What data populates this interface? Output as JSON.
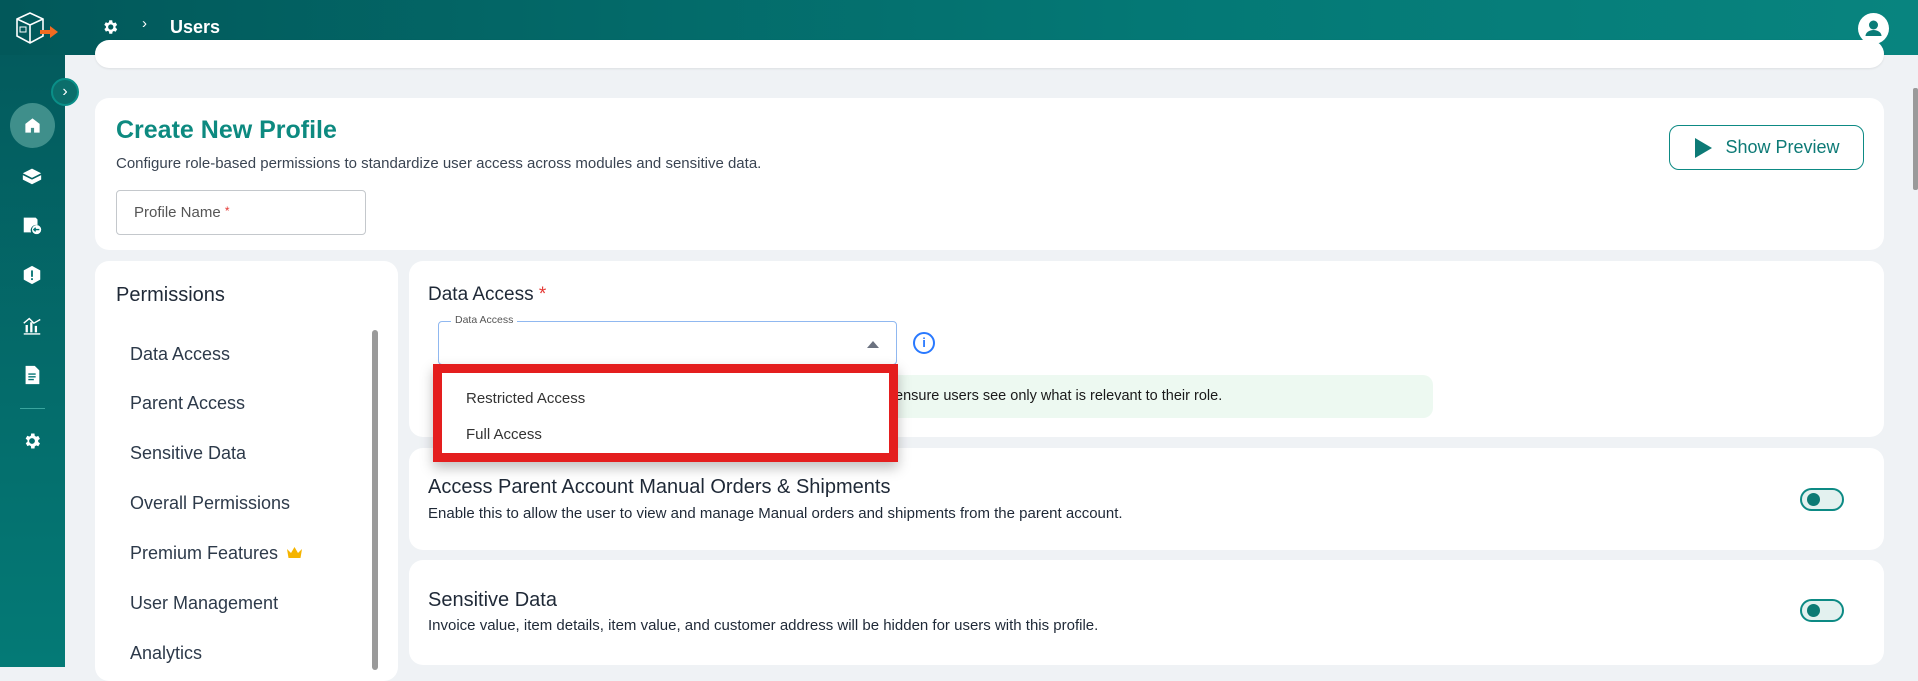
{
  "header": {
    "breadcrumb_current": "Users"
  },
  "sidebar": {
    "items": [
      "home",
      "orders",
      "returns",
      "issues",
      "analytics",
      "reports",
      "settings"
    ]
  },
  "create_profile": {
    "title": "Create New Profile",
    "subtitle": "Configure role-based permissions to standardize user access across modules and sensitive data.",
    "profile_name_placeholder": "Profile Name",
    "required_mark": "*",
    "show_preview_label": "Show Preview"
  },
  "permissions": {
    "title": "Permissions",
    "items": [
      "Data Access",
      "Parent Access",
      "Sensitive Data",
      "Overall Permissions",
      "Premium Features",
      "User Management",
      "Analytics"
    ]
  },
  "data_access": {
    "title": "Data Access",
    "required_mark": "*",
    "select_label": "Data Access",
    "select_value": "",
    "options": [
      "Restricted Access",
      "Full Access"
    ],
    "info_text_visible": "ensure users see only what is relevant to their role."
  },
  "parent_orders": {
    "title": "Access Parent Account Manual Orders & Shipments",
    "description": "Enable this to allow the user to view and manage Manual orders and shipments from the parent account.",
    "enabled": false
  },
  "sensitive_data": {
    "title": "Sensitive Data",
    "description": "Invoice value, item details, item value, and customer address will be hidden for users with this profile.",
    "enabled": false
  },
  "colors": {
    "brand": "#0d8a80",
    "highlight": "#e41e1e",
    "info": "#2979ff"
  }
}
